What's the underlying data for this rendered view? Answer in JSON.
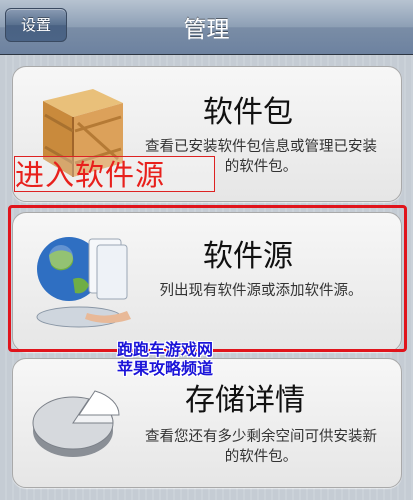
{
  "navbar": {
    "back_label": "设置",
    "title": "管理"
  },
  "cards": [
    {
      "title": "软件包",
      "description": "查看已安装软件包信息或管理已安装的软件包。",
      "icon": "package-box-icon"
    },
    {
      "title": "软件源",
      "description": "列出现有软件源或添加软件源。",
      "icon": "globe-source-icon"
    },
    {
      "title": "存储详情",
      "description": "查看您还有多少剩余空间可供安装新的软件包。",
      "icon": "storage-pie-icon"
    }
  ],
  "annotation": {
    "label": "进入软件源",
    "color": "#e0141c"
  },
  "watermark": {
    "line1": "跑跑车游戏网",
    "line2": "苹果攻略频道"
  }
}
